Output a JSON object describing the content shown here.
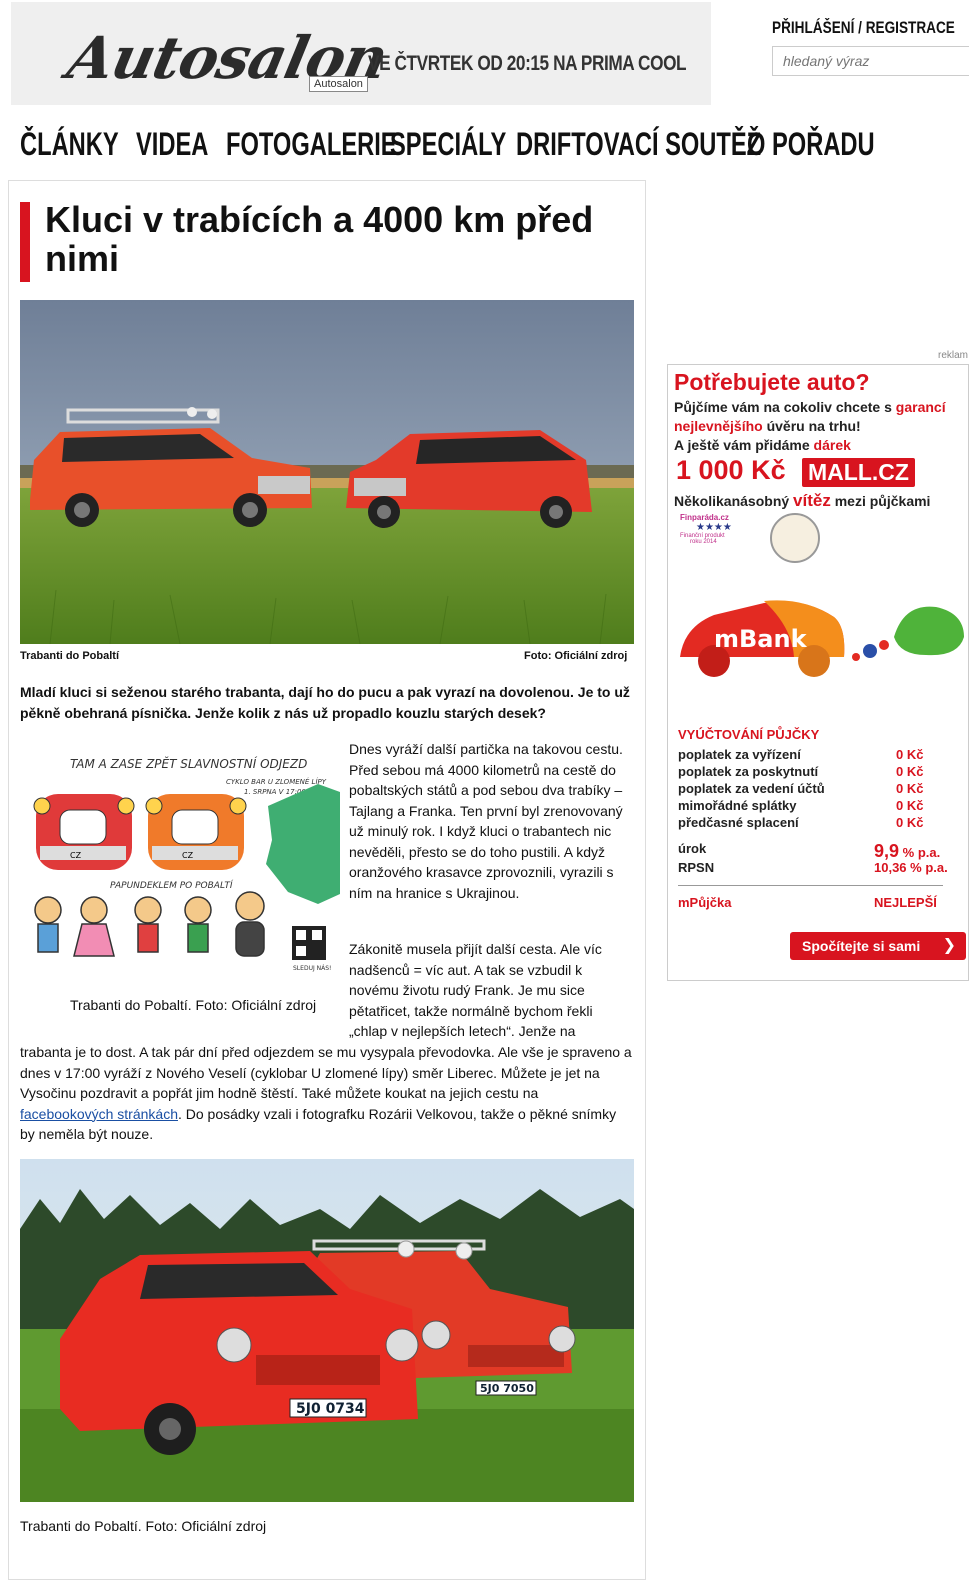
{
  "header": {
    "logo_text": "Autosalon",
    "logo_badge": "Autosalon",
    "tagline": "VE ČTVRTEK OD 20:15 NA PRIMA COOL",
    "login_label": "PŘIHLÁŠENÍ / REGISTRACE",
    "search_placeholder": "hledaný výraz"
  },
  "nav": {
    "items": [
      "ČLÁNKY",
      "VIDEA",
      "FOTOGALERIE",
      "SPECIÁLY",
      "DRIFTOVACÍ SOUTĚŽ",
      "O POŘADU"
    ]
  },
  "article": {
    "title": "Kluci v trabících a 4000 km před nimi",
    "photo1_caption": "Trabanti do Pobaltí",
    "photo1_credit": "Foto: Oficiální zdroj",
    "lead": "Mladí kluci si seženou starého trabanta, dají ho do pucu a pak vyrazí na dovolenou. Je to už pěkně obehraná písnička. Jenže kolik z nás už propadlo kouzlu starých desek?",
    "illustration": {
      "heading": "TAM A ZASE ZPĚT SLAVNOSTNÍ ODJEZD",
      "subtitle_line1": "CYKLO BAR U ZLOMENÉ LÍPY",
      "subtitle_line2": "1. SRPNA V 17:00",
      "plate": "CZ",
      "slogan": "PAPUNDEKLEM PO POBALTÍ",
      "qr_label": "SLEDUJ NÁS!"
    },
    "illustration_caption": "Trabanti do Pobaltí. Foto: Oficiální zdroj",
    "paragraph1": "Dnes vyráží další partička na takovou cestu. Před sebou má 4000 kilometrů na cestě do pobaltských států a pod sebou dva trabíky – Tajlang a Franka. Ten první byl zrenovovaný už minulý rok. I když kluci o trabantech nic nevěděli, přesto se do toho pustili. A když oranžového krasavce zprovoznili, vyrazili s ním na hranice s Ukrajinou.",
    "paragraph2_part1": "Zákonitě musela přijít další cesta. Ale víc nadšenců = víc aut. A tak se vzbudil k novému životu rudý Frank. Je mu sice pětatřicet, takže normálně bychom řekli „chlap v nejlepších letech“. Jenže na",
    "paragraph2_part2": "trabanta je to dost. A tak pár dní před odjezdem se mu vysypala převodovka. Ale vše je spraveno a dnes v 17:00 vyráží z Nového Veselí (cyklobar U zlomené lípy) směr Liberec. Můžete je jet na Vysočinu pozdravit a popřát jim hodně štěstí. Také můžete koukat na jejich cestu na ",
    "paragraph2_link": "facebookových stránkách",
    "paragraph2_part3": ". Do posádky vzali i fotografku Rozárii Velkovou, takže o pěkné snímky by neměla být nouze.",
    "photo2_plate_left": "5J0 7050",
    "photo2_plate_right": "5J0 0734",
    "photo2_caption": "Trabanti do Pobaltí. Foto: Oficiální zdroj"
  },
  "ad": {
    "label": "reklam",
    "heading": "Potřebujete auto?",
    "line1a": "Půjčíme vám na cokoliv chcete s ",
    "line1b": "garancí",
    "line2a": "nejlevnějšího",
    "line2b": " úvěru na trhu!",
    "line3a": "A ještě vám přidáme ",
    "line3b": "dárek",
    "amount": "1 000 Kč",
    "mall": "MALL.CZ",
    "line4a": "Několikanásobný ",
    "line4b": "vítěz",
    "line4c": " mezi půjčkami",
    "award_name": "Finparáda.cz",
    "award_sub1": "Finanční produkt",
    "award_sub2": "roku 2014",
    "bank": "mBank",
    "section_title": "VYÚČTOVÁNÍ PŮJČKY",
    "fees": [
      {
        "label": "poplatek za vyřízení",
        "value": "0 Kč"
      },
      {
        "label": "poplatek za poskytnutí",
        "value": "0 Kč"
      },
      {
        "label": "poplatek za vedení účtů",
        "value": "0 Kč"
      },
      {
        "label": "mimořádné splátky",
        "value": "0 Kč"
      },
      {
        "label": "předčasné splacení",
        "value": "0 Kč"
      }
    ],
    "rate_label": "úrok",
    "rate_value": "9,9",
    "rate_unit": "% p.a.",
    "rpsn_label": "RPSN",
    "rpsn_value": "10,36 % p.a.",
    "product": "mPůjčka",
    "product_tag": "NEJLEPŠÍ",
    "cta": "Spočítejte si sami"
  },
  "colors": {
    "accent": "#d8141f",
    "link": "#1a4fa3"
  }
}
